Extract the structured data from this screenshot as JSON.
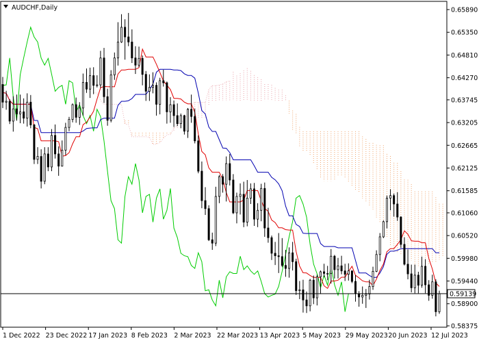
{
  "chart_data": {
    "type": "candlestick",
    "title": "AUDCHF,Daily",
    "colors": {
      "background": "#ffffff",
      "frame": "#000000",
      "bull_candle": "#ffffff",
      "bear_candle": "#000000",
      "tenkan_sen": "#e00000",
      "kijun_sen": "#0000b0",
      "chikou_span": "#00cc00",
      "kumo_bullish": "#e9a0a8",
      "kumo_bearish": "#f0a36a",
      "price_line": "#000000"
    },
    "y_axis": {
      "ticks": [
        "0.65890",
        "0.65350",
        "0.64810",
        "0.64270",
        "0.63745",
        "0.63205",
        "0.62665",
        "0.62125",
        "0.61585",
        "0.61060",
        "0.60520",
        "0.59980",
        "0.59440",
        "0.58900",
        "0.58375"
      ],
      "range": [
        0.58375,
        0.6589
      ],
      "current_price_label": "0.59139",
      "current_price": 0.59139
    },
    "x_axis": {
      "labels": [
        "1 Dec 2022",
        "23 Dec 2022",
        "17 Jan 2023",
        "8 Feb 2023",
        "2 Mar 2023",
        "22 Mar 2023",
        "13 Apr 2023",
        "5 May 2023",
        "29 May 2023",
        "20 Jun 2023",
        "12 Jul 2023"
      ]
    },
    "ohlc": [
      [
        0.6411,
        0.6429,
        0.6355,
        0.6369
      ],
      [
        0.6369,
        0.6396,
        0.6351,
        0.6371
      ],
      [
        0.6371,
        0.6376,
        0.6317,
        0.6324
      ],
      [
        0.6324,
        0.6383,
        0.6299,
        0.6353
      ],
      [
        0.6353,
        0.6387,
        0.6325,
        0.6341
      ],
      [
        0.6341,
        0.6387,
        0.6319,
        0.6346
      ],
      [
        0.6346,
        0.6378,
        0.6318,
        0.6331
      ],
      [
        0.6331,
        0.639,
        0.6311,
        0.6369
      ],
      [
        0.6369,
        0.6386,
        0.6307,
        0.6315
      ],
      [
        0.6315,
        0.6317,
        0.6222,
        0.6233
      ],
      [
        0.6233,
        0.6262,
        0.6222,
        0.624
      ],
      [
        0.624,
        0.6257,
        0.6164,
        0.6181
      ],
      [
        0.6181,
        0.6262,
        0.6174,
        0.6246
      ],
      [
        0.6246,
        0.6262,
        0.6205,
        0.6215
      ],
      [
        0.6215,
        0.6305,
        0.6205,
        0.629
      ],
      [
        0.629,
        0.6316,
        0.6235,
        0.6246
      ],
      [
        0.6246,
        0.6264,
        0.6194,
        0.6217
      ],
      [
        0.6217,
        0.6278,
        0.6216,
        0.6255
      ],
      [
        0.6255,
        0.632,
        0.6243,
        0.6309
      ],
      [
        0.6309,
        0.6334,
        0.63,
        0.6328
      ],
      [
        0.6328,
        0.6366,
        0.6321,
        0.6363
      ],
      [
        0.6363,
        0.638,
        0.632,
        0.6333
      ],
      [
        0.6333,
        0.6369,
        0.6315,
        0.6355
      ],
      [
        0.6355,
        0.6437,
        0.6337,
        0.6416
      ],
      [
        0.6416,
        0.6449,
        0.6391,
        0.64
      ],
      [
        0.64,
        0.6451,
        0.6379,
        0.6432
      ],
      [
        0.6432,
        0.6452,
        0.6388,
        0.6409
      ],
      [
        0.6409,
        0.6433,
        0.6404,
        0.641
      ],
      [
        0.641,
        0.6491,
        0.6403,
        0.6474
      ],
      [
        0.6474,
        0.6498,
        0.6367,
        0.6382
      ],
      [
        0.6382,
        0.6401,
        0.6313,
        0.6326
      ],
      [
        0.6326,
        0.6445,
        0.6321,
        0.6434
      ],
      [
        0.6434,
        0.6487,
        0.6422,
        0.6474
      ],
      [
        0.6474,
        0.6559,
        0.6456,
        0.6512
      ],
      [
        0.6512,
        0.6578,
        0.651,
        0.6547
      ],
      [
        0.6547,
        0.6566,
        0.647,
        0.6524
      ],
      [
        0.6524,
        0.6581,
        0.6502,
        0.6512
      ],
      [
        0.6512,
        0.6542,
        0.6462,
        0.6474
      ],
      [
        0.6474,
        0.6502,
        0.6436,
        0.6457
      ],
      [
        0.6457,
        0.6501,
        0.6452,
        0.6473
      ],
      [
        0.6473,
        0.648,
        0.6409,
        0.6435
      ],
      [
        0.6435,
        0.6443,
        0.6372,
        0.6395
      ],
      [
        0.6395,
        0.6435,
        0.6372,
        0.6404
      ],
      [
        0.6404,
        0.644,
        0.639,
        0.6409
      ],
      [
        0.6409,
        0.6416,
        0.6337,
        0.6364
      ],
      [
        0.6364,
        0.6427,
        0.634,
        0.642
      ],
      [
        0.642,
        0.6446,
        0.6406,
        0.6415
      ],
      [
        0.6415,
        0.6418,
        0.6318,
        0.6346
      ],
      [
        0.6346,
        0.6381,
        0.632,
        0.6363
      ],
      [
        0.6363,
        0.6373,
        0.631,
        0.6337
      ],
      [
        0.6337,
        0.6366,
        0.6312,
        0.6318
      ],
      [
        0.6318,
        0.6342,
        0.6307,
        0.6337
      ],
      [
        0.6337,
        0.6339,
        0.6292,
        0.63
      ],
      [
        0.63,
        0.6355,
        0.6284,
        0.6352
      ],
      [
        0.6352,
        0.6387,
        0.632,
        0.6335
      ],
      [
        0.6335,
        0.6354,
        0.6271,
        0.6277
      ],
      [
        0.6277,
        0.629,
        0.62,
        0.6205
      ],
      [
        0.6205,
        0.6228,
        0.6117,
        0.6135
      ],
      [
        0.6135,
        0.6167,
        0.6101,
        0.6116
      ],
      [
        0.6116,
        0.6124,
        0.6039,
        0.6042
      ],
      [
        0.6042,
        0.6059,
        0.6018,
        0.6034
      ],
      [
        0.6034,
        0.6168,
        0.6027,
        0.6145
      ],
      [
        0.6145,
        0.6196,
        0.6129,
        0.6192
      ],
      [
        0.6192,
        0.6198,
        0.6154,
        0.6174
      ],
      [
        0.6174,
        0.624,
        0.6133,
        0.6223
      ],
      [
        0.6223,
        0.6246,
        0.6171,
        0.6184
      ],
      [
        0.6184,
        0.6198,
        0.6103,
        0.6106
      ],
      [
        0.6106,
        0.6154,
        0.6081,
        0.6145
      ],
      [
        0.6145,
        0.6176,
        0.6102,
        0.615
      ],
      [
        0.615,
        0.618,
        0.6072,
        0.6084
      ],
      [
        0.6084,
        0.6184,
        0.6074,
        0.6141
      ],
      [
        0.6141,
        0.6176,
        0.6127,
        0.6163
      ],
      [
        0.6163,
        0.6177,
        0.6075,
        0.6091
      ],
      [
        0.6091,
        0.6129,
        0.6072,
        0.6112
      ],
      [
        0.6112,
        0.6175,
        0.6086,
        0.6164
      ],
      [
        0.6164,
        0.6178,
        0.6049,
        0.607
      ],
      [
        0.607,
        0.6118,
        0.6035,
        0.6047
      ],
      [
        0.6047,
        0.6052,
        0.5994,
        0.601
      ],
      [
        0.601,
        0.6037,
        0.5982,
        0.6004
      ],
      [
        0.6004,
        0.6058,
        0.5963,
        0.6002
      ],
      [
        0.6002,
        0.6046,
        0.5977,
        0.5981
      ],
      [
        0.5981,
        0.6018,
        0.5954,
        0.5974
      ],
      [
        0.5974,
        0.6024,
        0.5952,
        0.6011
      ],
      [
        0.6011,
        0.6037,
        0.5969,
        0.599
      ],
      [
        0.599,
        0.5997,
        0.5911,
        0.5921
      ],
      [
        0.5921,
        0.5944,
        0.5901,
        0.5923
      ],
      [
        0.5923,
        0.5947,
        0.5869,
        0.5899
      ],
      [
        0.5899,
        0.5919,
        0.5868,
        0.5885
      ],
      [
        0.5885,
        0.5949,
        0.5872,
        0.5946
      ],
      [
        0.5946,
        0.5957,
        0.5889,
        0.5904
      ],
      [
        0.5904,
        0.5959,
        0.5886,
        0.5954
      ],
      [
        0.5954,
        0.5969,
        0.5913,
        0.5966
      ],
      [
        0.5966,
        0.5985,
        0.5953,
        0.5962
      ],
      [
        0.5962,
        0.598,
        0.5946,
        0.5962
      ],
      [
        0.5962,
        0.602,
        0.5938,
        0.6003
      ],
      [
        0.6003,
        0.6006,
        0.595,
        0.5971
      ],
      [
        0.5971,
        0.5999,
        0.595,
        0.598
      ],
      [
        0.598,
        0.6004,
        0.596,
        0.5968
      ],
      [
        0.5968,
        0.5985,
        0.5944,
        0.596
      ],
      [
        0.596,
        0.5986,
        0.5945,
        0.5968
      ],
      [
        0.5968,
        0.5969,
        0.5939,
        0.5943
      ],
      [
        0.5943,
        0.5958,
        0.5895,
        0.5914
      ],
      [
        0.5914,
        0.592,
        0.5883,
        0.5906
      ],
      [
        0.5906,
        0.5931,
        0.589,
        0.591
      ],
      [
        0.591,
        0.5925,
        0.588,
        0.5913
      ],
      [
        0.5913,
        0.5947,
        0.59,
        0.5931
      ],
      [
        0.5931,
        0.5978,
        0.5923,
        0.5967
      ],
      [
        0.5967,
        0.6017,
        0.5965,
        0.6007
      ],
      [
        0.6007,
        0.6058,
        0.5991,
        0.6049
      ],
      [
        0.6049,
        0.6088,
        0.6046,
        0.6085
      ],
      [
        0.6085,
        0.6147,
        0.6069,
        0.6141
      ],
      [
        0.6141,
        0.6162,
        0.6112,
        0.6147
      ],
      [
        0.6147,
        0.6152,
        0.6097,
        0.6127
      ],
      [
        0.6127,
        0.6155,
        0.6087,
        0.6096
      ],
      [
        0.6096,
        0.6098,
        0.6023,
        0.6031
      ],
      [
        0.6031,
        0.6048,
        0.5981,
        0.5984
      ],
      [
        0.5984,
        0.6019,
        0.5948,
        0.5961
      ],
      [
        0.5961,
        0.5983,
        0.5917,
        0.5928
      ],
      [
        0.5928,
        0.5983,
        0.5915,
        0.5958
      ],
      [
        0.5958,
        0.5966,
        0.5915,
        0.5934
      ],
      [
        0.5934,
        0.6002,
        0.5928,
        0.5979
      ],
      [
        0.5979,
        0.5996,
        0.5915,
        0.5935
      ],
      [
        0.5935,
        0.5946,
        0.5897,
        0.591
      ],
      [
        0.591,
        0.5959,
        0.5902,
        0.5942
      ],
      [
        0.5942,
        0.5948,
        0.586,
        0.5871
      ],
      [
        0.5871,
        0.5921,
        0.5866,
        0.5914
      ]
    ]
  }
}
